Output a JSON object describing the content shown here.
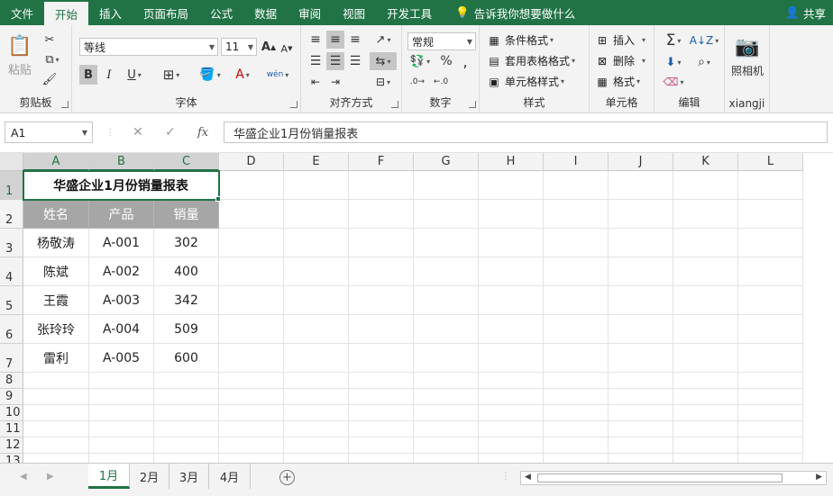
{
  "ribbon_tabs": [
    "文件",
    "开始",
    "插入",
    "页面布局",
    "公式",
    "数据",
    "审阅",
    "视图",
    "开发工具"
  ],
  "active_tab": "开始",
  "tell_me": "告诉我你想要做什么",
  "share": "共享",
  "ribbon": {
    "clipboard": {
      "label": "剪贴板",
      "paste": "粘贴"
    },
    "font": {
      "label": "字体",
      "name": "等线",
      "size": "11",
      "bold": "B",
      "italic": "I",
      "underline": "U",
      "grow": "A",
      "shrink": "A",
      "color_a": "A",
      "wen": "wén"
    },
    "alignment": {
      "label": "对齐方式"
    },
    "number": {
      "label": "数字",
      "format": "常规",
      "percent": "%",
      "comma": ","
    },
    "styles": {
      "label": "样式",
      "conditional": "条件格式",
      "table": "套用表格格式",
      "cell": "单元格样式"
    },
    "cells": {
      "label": "单元格",
      "insert": "插入",
      "delete": "删除",
      "format": "格式"
    },
    "editing": {
      "label": "编辑",
      "sigma": "Σ"
    },
    "xiangji": {
      "label": "xiangji",
      "camera": "照相机"
    }
  },
  "formula_bar": {
    "name_box": "A1",
    "cancel": "✕",
    "enter": "✓",
    "fx": "fx",
    "content": "华盛企业1月份销量报表"
  },
  "columns": [
    "A",
    "B",
    "C",
    "D",
    "E",
    "F",
    "G",
    "H",
    "I",
    "J",
    "K",
    "L"
  ],
  "rows": [
    "1",
    "2",
    "3",
    "4",
    "5",
    "6",
    "7",
    "8",
    "9",
    "10",
    "11",
    "12",
    "13"
  ],
  "sheet": {
    "title": "华盛企业1月份销量报表",
    "headers": [
      "姓名",
      "产品",
      "销量"
    ],
    "data": [
      [
        "杨敬涛",
        "A-001",
        "302"
      ],
      [
        "陈斌",
        "A-002",
        "400"
      ],
      [
        "王霞",
        "A-003",
        "342"
      ],
      [
        "张玲玲",
        "A-004",
        "509"
      ],
      [
        "雷利",
        "A-005",
        "600"
      ]
    ]
  },
  "sheet_tabs": [
    "1月",
    "2月",
    "3月",
    "4月"
  ],
  "active_sheet": "1月",
  "colors": {
    "accent": "#217346",
    "header_fill": "#a6a6a6",
    "ribbon_bg": "#f3f3f3"
  }
}
